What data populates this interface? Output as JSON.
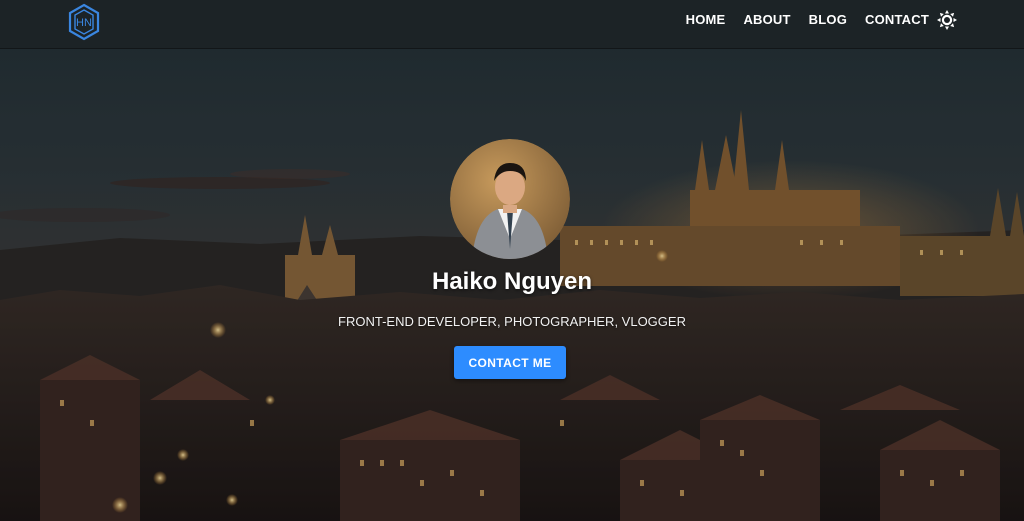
{
  "nav": {
    "logo_text": "HN",
    "links": [
      "HOME",
      "ABOUT",
      "BLOG",
      "CONTACT"
    ],
    "theme_icon": "sun-icon"
  },
  "hero": {
    "name": "Haiko Nguyen",
    "subtitle": "FRONT-END DEVELOPER, PHOTOGRAPHER, VLOGGER",
    "cta_label": "CONTACT ME",
    "background": "night-city-skyline-photo",
    "avatar": "profile-photo"
  },
  "colors": {
    "accent": "#2d8cff",
    "logo": "#3a86e0",
    "navbar": "#1c2226"
  }
}
